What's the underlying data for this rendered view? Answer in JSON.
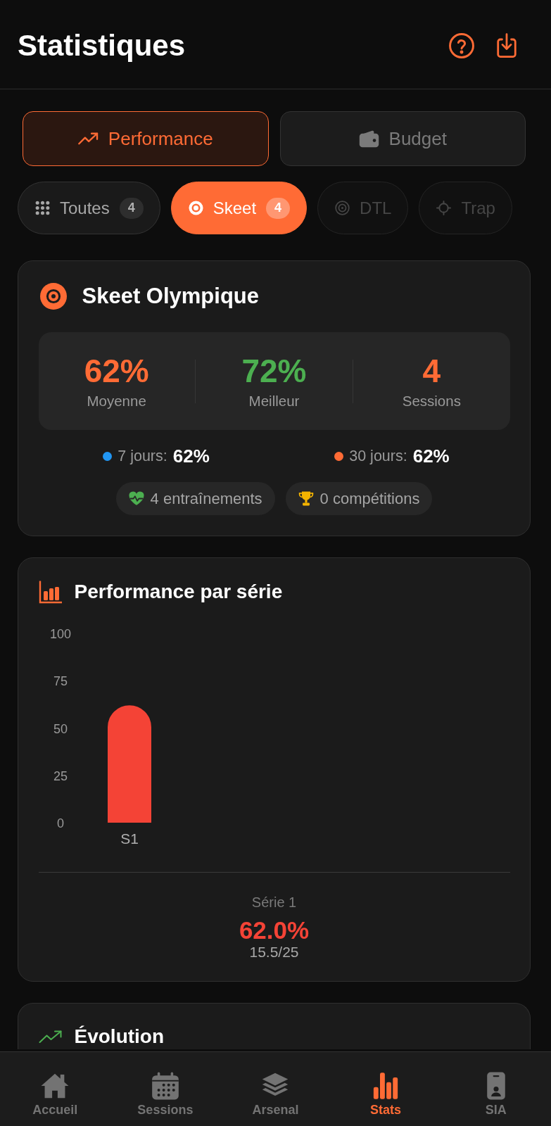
{
  "header": {
    "title": "Statistiques"
  },
  "mode_tabs": [
    {
      "label": "Performance",
      "selected": true
    },
    {
      "label": "Budget",
      "selected": false
    }
  ],
  "filters": [
    {
      "label": "Toutes",
      "count": "4",
      "selected": false,
      "disabled": false
    },
    {
      "label": "Skeet",
      "count": "4",
      "selected": true,
      "disabled": false
    },
    {
      "label": "DTL",
      "selected": false,
      "disabled": true
    },
    {
      "label": "Trap",
      "selected": false,
      "disabled": true
    }
  ],
  "summary_card": {
    "title": "Skeet Olympique",
    "stats": [
      {
        "value": "62%",
        "label": "Moyenne",
        "color": "#ff6b35"
      },
      {
        "value": "72%",
        "label": "Meilleur",
        "color": "#4caf50"
      },
      {
        "value": "4",
        "label": "Sessions",
        "color": "#ff6b35"
      }
    ],
    "periods": [
      {
        "label": "7 jours:",
        "value": "62%",
        "color": "#2196f3"
      },
      {
        "label": "30 jours:",
        "value": "62%",
        "color": "#ff6b35"
      }
    ],
    "tags": [
      "4 entraînements",
      "0 compétitions"
    ]
  },
  "series_card": {
    "title": "Performance par série",
    "chart_data": {
      "type": "bar",
      "categories": [
        "S1"
      ],
      "values": [
        62
      ],
      "ylim": [
        0,
        100
      ],
      "yticks": [
        0,
        25,
        50,
        75,
        100
      ]
    },
    "detail": {
      "label": "Série 1",
      "percent": "62.0%",
      "score": "15.5/25"
    }
  },
  "evolution_card": {
    "title": "Évolution"
  },
  "nav": [
    {
      "label": "Accueil",
      "selected": false
    },
    {
      "label": "Sessions",
      "selected": false
    },
    {
      "label": "Arsenal",
      "selected": false
    },
    {
      "label": "Stats",
      "selected": true
    },
    {
      "label": "SIA",
      "selected": false
    }
  ]
}
